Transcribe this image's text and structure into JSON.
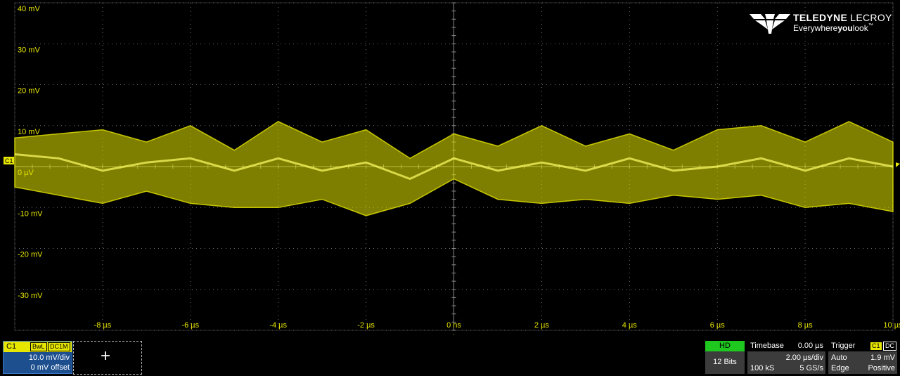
{
  "screen": {
    "trace_color": "#e6e600",
    "grid_color": "#6e6e6e",
    "background": "#000000"
  },
  "chart_data": {
    "type": "line",
    "title": "",
    "xlabel": "",
    "ylabel": "",
    "xlim": [
      -10,
      10
    ],
    "ylim": [
      -40,
      40
    ],
    "x_unit": "µs",
    "y_unit": "mV",
    "y_ticks": [
      "40 mV",
      "30 mV",
      "20 mV",
      "10 mV",
      "0 µV",
      "-10 mV",
      "-20 mV",
      "-30 mV"
    ],
    "x_ticks": [
      "-8 µs",
      "-6 µs",
      "-4 µs",
      "-2 µs",
      "0 ns",
      "2 µs",
      "4 µs",
      "6 µs",
      "8 µs",
      "10 µs"
    ],
    "grid": true,
    "series": [
      {
        "x": [
          -10,
          -9,
          -8,
          -7,
          -6,
          -5,
          -4,
          -3,
          -2,
          -1,
          0,
          1,
          2,
          3,
          4,
          5,
          6,
          7,
          8,
          9,
          10
        ],
        "center": [
          3,
          2,
          -1,
          1,
          2,
          -1,
          2,
          -1,
          1,
          -3,
          2,
          -1,
          1,
          -1,
          2,
          -1,
          0,
          2,
          -1,
          2,
          0
        ],
        "upper": [
          7,
          8,
          9,
          6,
          10,
          4,
          11,
          6,
          9,
          2,
          8,
          5,
          10,
          5,
          8,
          4,
          9,
          10,
          6,
          11,
          6
        ],
        "lower": [
          -5,
          -7,
          -9,
          -6,
          -9,
          -10,
          -10,
          -8,
          -12,
          -9,
          -3,
          -8,
          -9,
          -8,
          -9,
          -7,
          -8,
          -7,
          -10,
          -9,
          -11
        ]
      }
    ]
  },
  "channel_marker": {
    "label": "C1"
  },
  "trigger_marker_symbol": "▲",
  "logo": {
    "brand_bold": "TELEDYNE",
    "brand_light": "LECROY",
    "tagline_pre": "Everywhere",
    "tagline_bold": "you",
    "tagline_post": "look",
    "tm": "™"
  },
  "c1_panel": {
    "name": "C1",
    "tag1": "BwL",
    "tag2": "DC1M",
    "vdiv": "10.0 mV/div",
    "offset": "0 mV offset"
  },
  "add_panel": {
    "symbol": "+"
  },
  "hd_panel": {
    "label": "HD",
    "bits": "12 Bits"
  },
  "timebase_panel": {
    "title": "Timebase",
    "delay": "0.00 µs",
    "tdiv": "2.00 µs/div",
    "samples": "100 kS",
    "rate": "5 GS/s"
  },
  "trigger_panel": {
    "title": "Trigger",
    "source": "C1",
    "coupling": "DC",
    "mode": "Auto",
    "level": "1.9 mV",
    "type": "Edge",
    "slope": "Positive"
  }
}
